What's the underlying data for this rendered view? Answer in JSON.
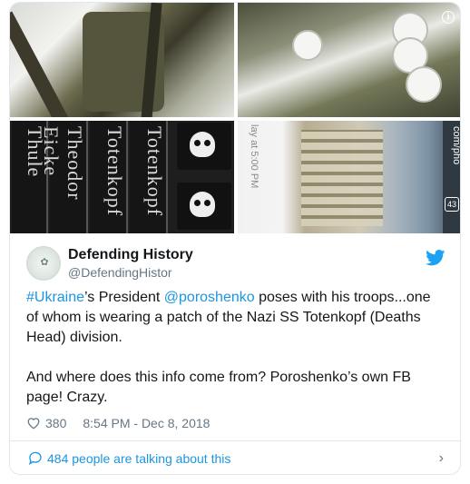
{
  "media": {
    "patch_texts": [
      "Thule",
      "Theodor Eicke",
      "Totenkopf",
      "Totenkopf"
    ],
    "phone_text": "lay at 5:00 PM",
    "url_fragment": "com/pho",
    "tab_count": "43"
  },
  "author": {
    "name": "Defending History",
    "handle": "@DefendingHistor"
  },
  "tweet": {
    "hashtag": "#Ukraine",
    "text_1": "’s President ",
    "mention": "@poroshenko",
    "text_2": " poses with his troops...one of whom is wearing a patch of the Nazi SS Totenkopf (Deaths Head) division.",
    "paragraph_2": "And where does this info come from? Poroshenko’s own FB page! Crazy."
  },
  "meta": {
    "likes": "380",
    "timestamp": "8:54 PM - Dec 8, 2018"
  },
  "footer": {
    "talking": "484 people are talking about this"
  },
  "colors": {
    "link": "#1b95e0",
    "twitter_blue": "#1da1f2",
    "secondary_text": "#657786"
  }
}
